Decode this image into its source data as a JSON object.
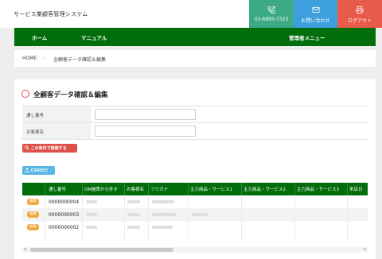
{
  "header": {
    "app_title": "サービス業顧客管理システム",
    "phone": "03-6895-7323",
    "contact": "お問い合わせ",
    "logout": "ログアウト"
  },
  "nav": {
    "home": "ホーム",
    "manual": "マニュアル",
    "admin_menu": "管理者メニュー"
  },
  "breadcrumb": {
    "home": "HOME",
    "separator": "›",
    "current": "全顧客データ確認＆編集"
  },
  "page": {
    "title": "全顧客データ確認＆編集"
  },
  "form": {
    "serial_label": "通し番号",
    "serial_value": "",
    "name_label": "お客様名",
    "name_value": "",
    "search_button": "この条件で検索する",
    "csv_button": "CSV出力"
  },
  "table": {
    "headers": [
      "通し番号",
      "DM施策から外す",
      "お客様名",
      "フリガナ",
      "主力商品・サービス1",
      "主力商品・サービス2",
      "主力商品・サービス3",
      "来店日"
    ],
    "edit_label": "編集",
    "rows": [
      {
        "id": "0000000004"
      },
      {
        "id": "0000000003"
      },
      {
        "id": "0000000002"
      }
    ]
  },
  "colors": {
    "nav_green": "#016d0b",
    "phone_teal": "#3daa86",
    "contact_blue": "#3d9fdd",
    "logout_red": "#e85a4a",
    "edit_orange": "#f0a93c"
  },
  "icons": {
    "phone": "phone-icon",
    "contact": "envelope-icon",
    "logout": "printer-icon",
    "search": "search-icon",
    "csv": "upload-icon"
  }
}
